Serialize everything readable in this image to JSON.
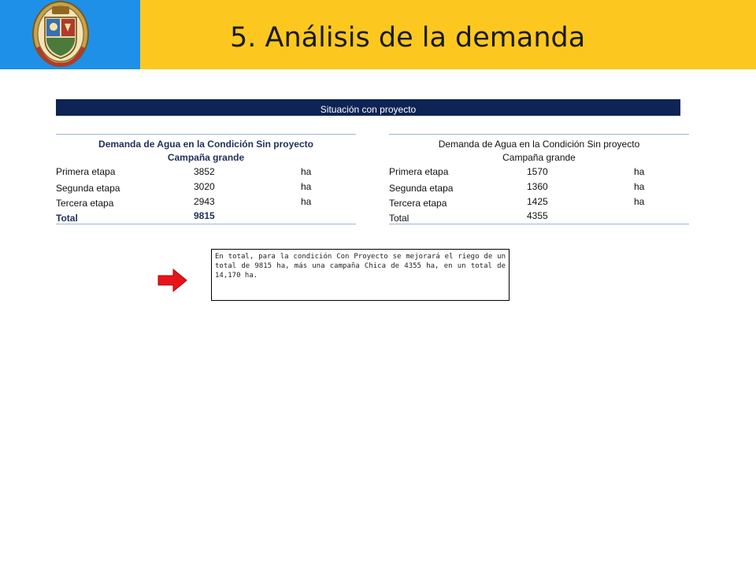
{
  "header": {
    "title": "5. Análisis de la demanda",
    "logo_icon": "university-crest-icon",
    "colors": {
      "band": "#FCC820",
      "logo_bg": "#1E90E8"
    }
  },
  "situacion_bar": {
    "label": "Situación con proyecto",
    "color": "#0E2455"
  },
  "table_left": {
    "title_line1": "Demanda de Agua en la Condición Sin proyecto",
    "title_line2": "Campaña grande",
    "rows": [
      {
        "etapa": "Primera etapa",
        "value": "3852",
        "unit": "ha"
      },
      {
        "etapa": "Segunda etapa",
        "value": "3020",
        "unit": "ha"
      },
      {
        "etapa": "Tercera etapa",
        "value": "2943",
        "unit": "ha"
      }
    ],
    "total_label": "Total",
    "total_value": "9815"
  },
  "table_right": {
    "title_line1": "Demanda de Agua en la Condición Sin proyecto",
    "title_line2": "Campaña grande",
    "rows": [
      {
        "etapa": "Primera etapa",
        "value": "1570",
        "unit": "ha"
      },
      {
        "etapa": "Segunda etapa",
        "value": "1360",
        "unit": "ha"
      },
      {
        "etapa": "Tercera etapa",
        "value": "1425",
        "unit": "ha"
      }
    ],
    "total_label": "Total",
    "total_value": "4355"
  },
  "note": {
    "arrow_icon": "right-arrow-icon",
    "text": "En total, para la condición Con Proyecto se mejorará el riego de un total de 9815 ha, más una campaña Chica de 4355 ha, en un total de 14,170 ha."
  }
}
